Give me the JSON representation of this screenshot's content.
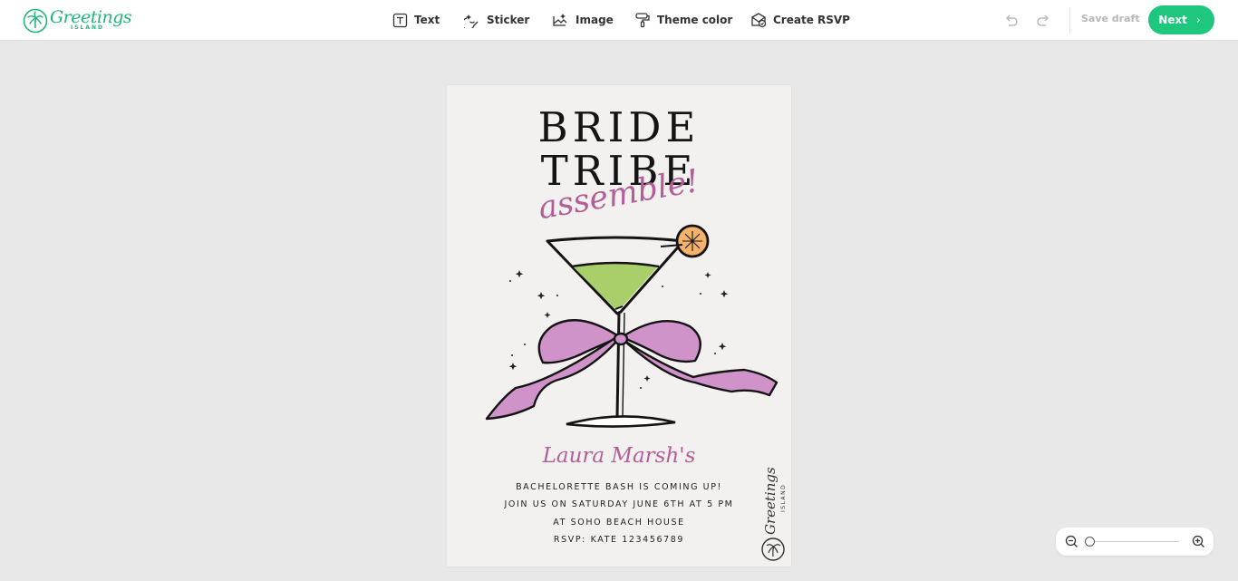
{
  "brand": {
    "name": "Greetings",
    "sub": "ISLAND",
    "color": "#1fb57a"
  },
  "toolbar": {
    "tools": [
      {
        "label": "Text",
        "icon": "text-icon"
      },
      {
        "label": "Sticker",
        "icon": "sticker-icon"
      },
      {
        "label": "Image",
        "icon": "image-icon"
      },
      {
        "label": "Theme color",
        "icon": "paint-roller-icon"
      },
      {
        "label": "Create RSVP",
        "icon": "rsvp-icon"
      }
    ],
    "save_draft": "Save draft",
    "next": "Next",
    "accent": "#1fc67e"
  },
  "card": {
    "headline_1": "BRIDE",
    "headline_2": "TRIBE",
    "script": "assemble!",
    "host": "Laura Marsh's",
    "lines": [
      "BACHELORETTE BASH IS COMING UP!",
      "JOIN US ON SATURDAY JUNE 6TH AT 5 PM",
      "AT SOHO BEACH HOUSE",
      "RSVP: KATE 123456789"
    ],
    "watermark_brand": "Greetings",
    "watermark_sub": "ISLAND",
    "script_color": "#b25f97",
    "ribbon_color": "#cf93c9",
    "drink_color": "#a9cf6a"
  },
  "zoom": {
    "level": 0
  }
}
